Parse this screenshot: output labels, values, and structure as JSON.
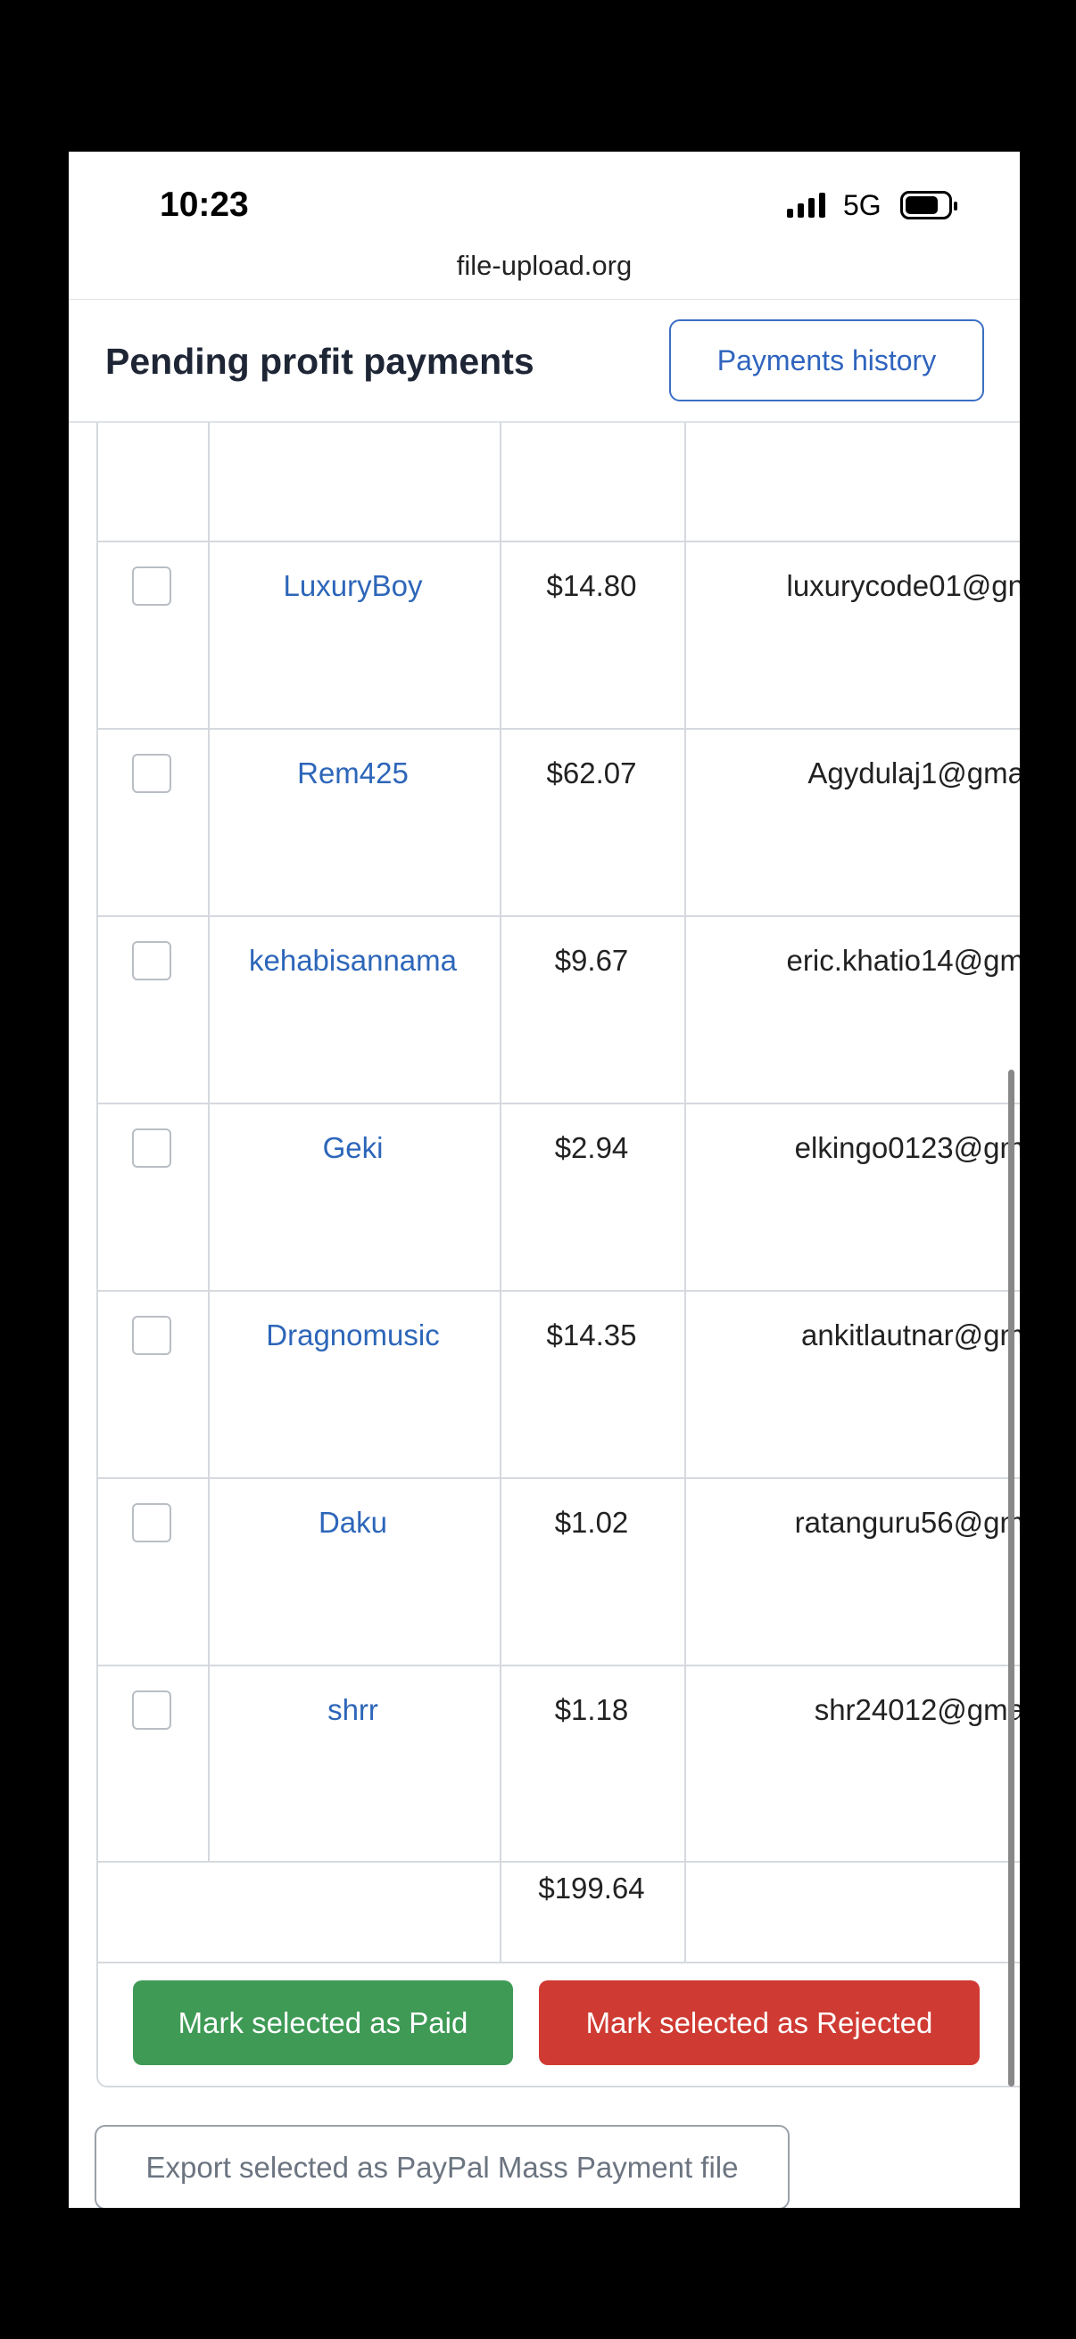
{
  "status_bar": {
    "time": "10:23",
    "network": "5G"
  },
  "browser": {
    "url": "file-upload.org"
  },
  "page": {
    "title": "Pending profit payments",
    "history_button": "Payments history"
  },
  "payments": [
    {
      "user": "LuxuryBoy",
      "amount": "$14.80",
      "email": "luxurycode01@gn"
    },
    {
      "user": "Rem425",
      "amount": "$62.07",
      "email": "Agydulaj1@gma"
    },
    {
      "user": "kehabisannama",
      "amount": "$9.67",
      "email": "eric.khatio14@gm"
    },
    {
      "user": "Geki",
      "amount": "$2.94",
      "email": "elkingo0123@gm"
    },
    {
      "user": "Dragnomusic",
      "amount": "$14.35",
      "email": "ankitlautnar@gm"
    },
    {
      "user": "Daku",
      "amount": "$1.02",
      "email": "ratanguru56@gm"
    },
    {
      "user": "shrr",
      "amount": "$1.18",
      "email": "shr24012@gma"
    }
  ],
  "total": "$199.64",
  "actions": {
    "mark_paid": "Mark selected as Paid",
    "mark_rejected": "Mark selected as Rejected",
    "export": "Export selected as PayPal Mass Payment file"
  },
  "colors": {
    "link": "#2d66b9",
    "paid_button": "#3e9a55",
    "rejected_button": "#cf3a32"
  }
}
